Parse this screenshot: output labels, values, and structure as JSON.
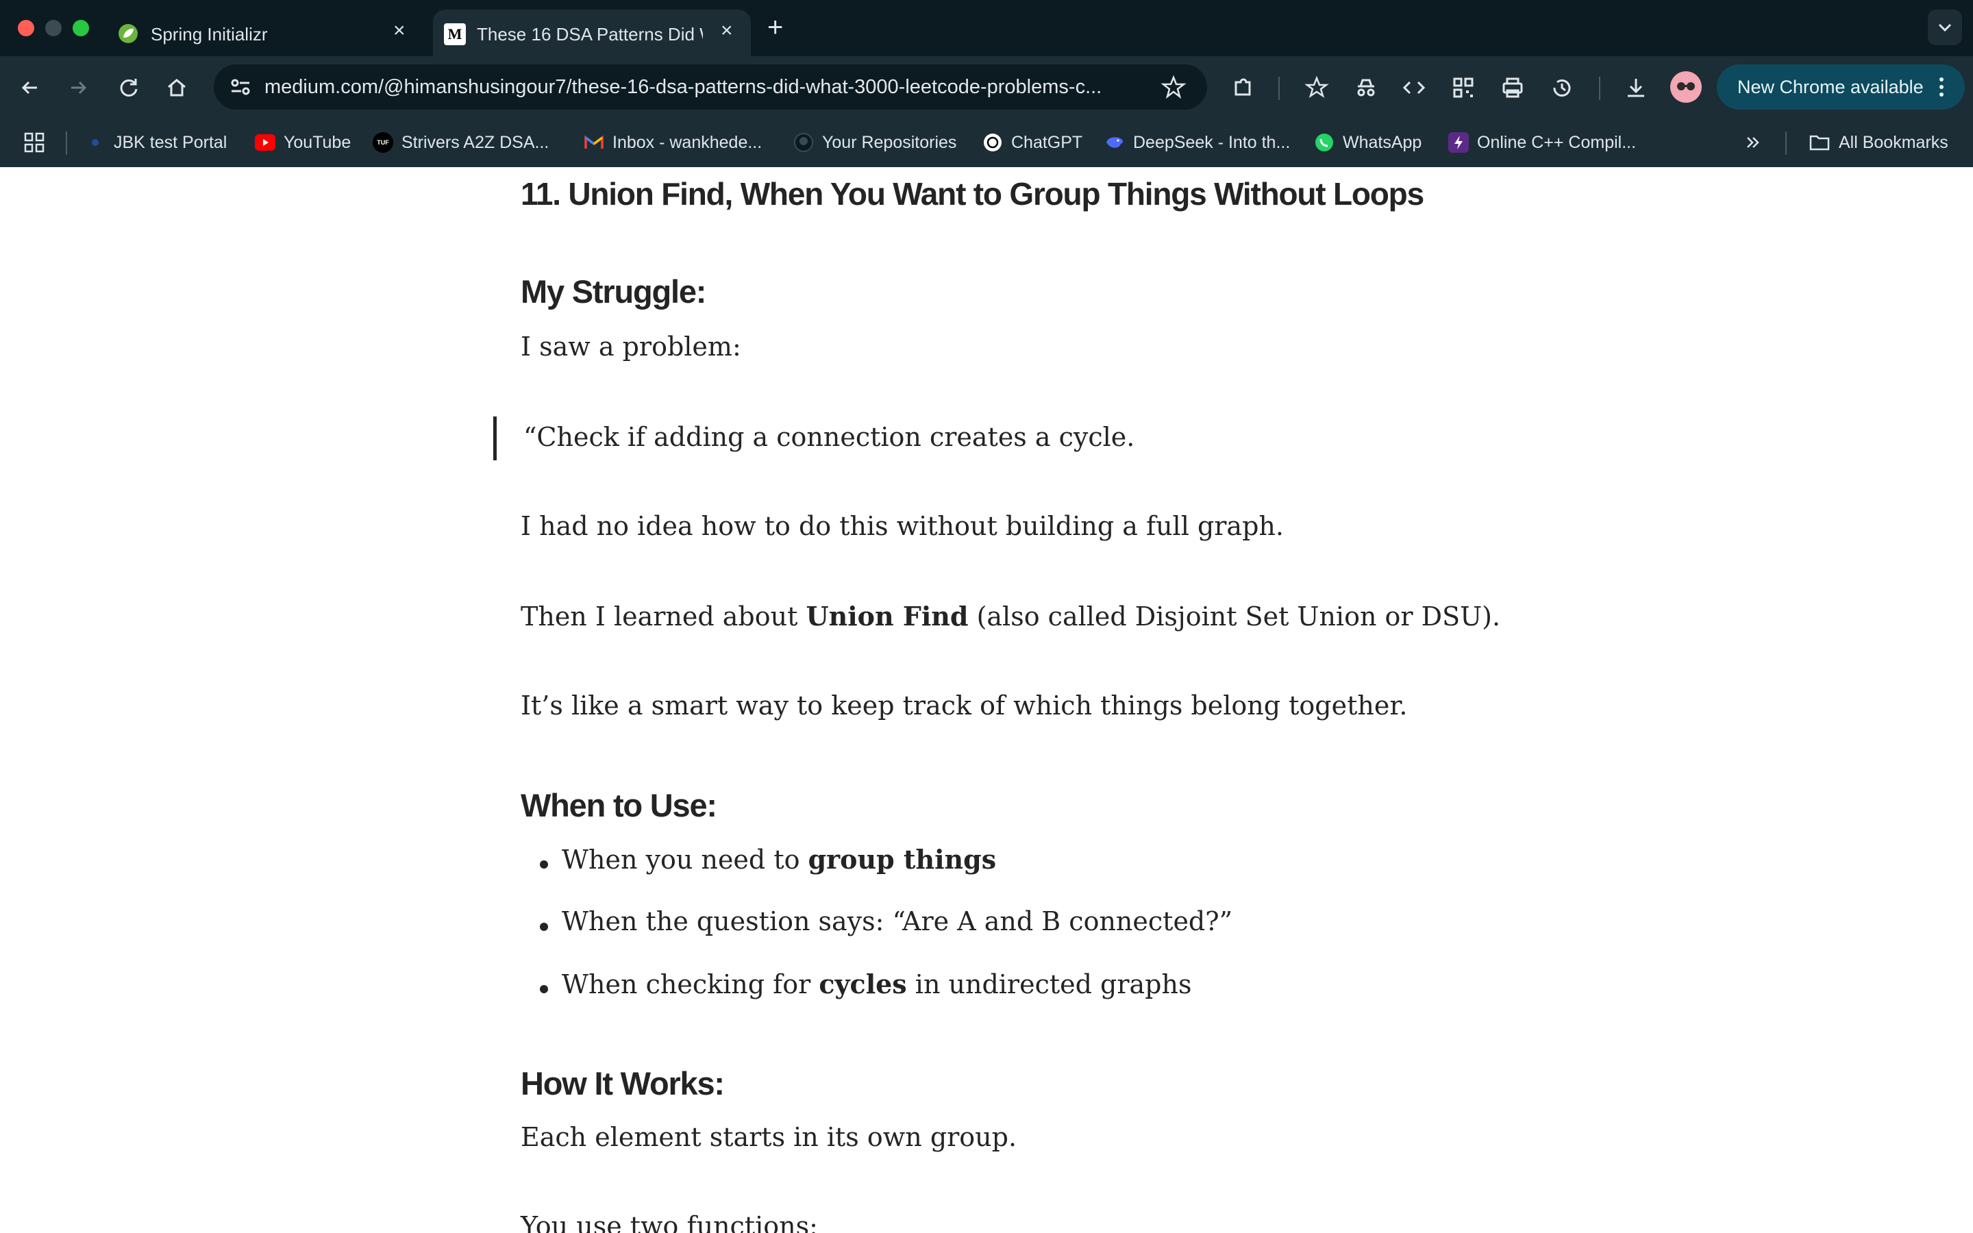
{
  "tabs": [
    {
      "title": "Spring Initializr",
      "icon": "spring-leaf-icon"
    },
    {
      "title": "These 16 DSA Patterns Did W",
      "icon": "medium-icon"
    }
  ],
  "toolbar": {
    "url": "medium.com/@himanshusingour7/these-16-dsa-patterns-did-what-3000-leetcode-problems-c...",
    "update_label": "New Chrome available"
  },
  "bookmarks": [
    {
      "label": "JBK test Portal"
    },
    {
      "label": "YouTube"
    },
    {
      "label": "Strivers A2Z DSA..."
    },
    {
      "label": "Inbox - wankhede..."
    },
    {
      "label": "Your Repositories"
    },
    {
      "label": "ChatGPT"
    },
    {
      "label": "DeepSeek - Into th..."
    },
    {
      "label": "WhatsApp"
    },
    {
      "label": "Online C++ Compil..."
    }
  ],
  "all_bookmarks": "All Bookmarks",
  "article": {
    "heading": "11. Union Find, When You Want to Group Things Without Loops",
    "struggle_heading": "My Struggle:",
    "p1": "I saw a problem:",
    "quote": "“Check if adding a connection creates a cycle.",
    "p2": "I had no idea how to do this without building a full graph.",
    "p3_pre": "Then I learned about ",
    "p3_bold": "Union Find",
    "p3_post": " (also called Disjoint Set Union or DSU).",
    "p4": "It’s like a smart way to keep track of which things belong together.",
    "when_heading": "When to Use:",
    "li1_pre": "When you need to ",
    "li1_bold": "group things",
    "li2": "When the question says: “Are A and B connected?”",
    "li3_pre": "When checking for ",
    "li3_bold": "cycles",
    "li3_post": " in undirected graphs",
    "how_heading": "How It Works:",
    "p5": "Each element starts in its own group.",
    "p6": "You use two functions:"
  }
}
